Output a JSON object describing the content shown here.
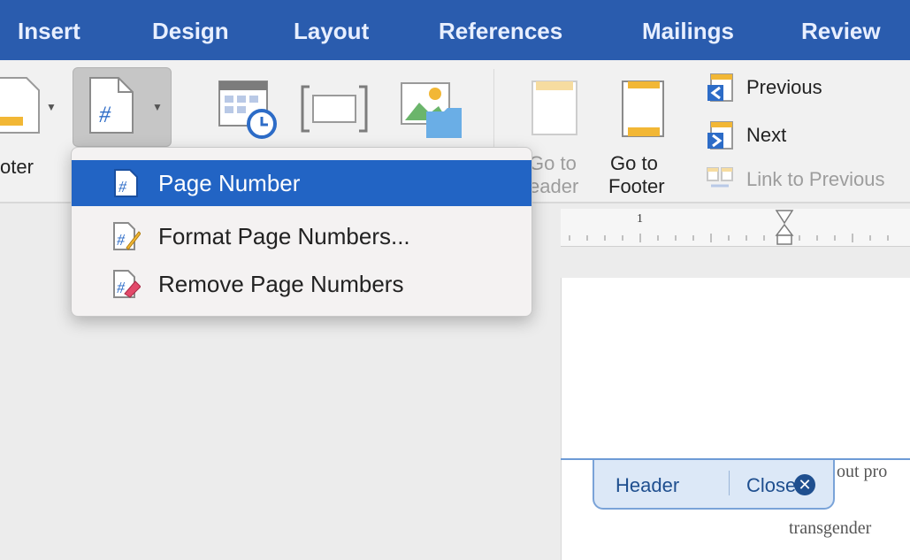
{
  "ribbon": {
    "tabs": [
      {
        "label": "Insert"
      },
      {
        "label": "Design"
      },
      {
        "label": "Layout"
      },
      {
        "label": "References"
      },
      {
        "label": "Mailings"
      },
      {
        "label": "Review"
      }
    ]
  },
  "toolbar": {
    "footer_label": "oter",
    "go_to_header_line1": "Go to",
    "go_to_header_line2": "eader",
    "go_to_footer_line1": "Go to",
    "go_to_footer_line2": "Footer",
    "previous_label": "Previous",
    "next_label": "Next",
    "link_to_previous_label": "Link to Previous"
  },
  "ruler": {
    "marker": "1"
  },
  "dropdown": {
    "items": [
      {
        "label": "Page Number",
        "icon": "page-number-icon",
        "selected": true
      },
      {
        "label": "Format Page Numbers...",
        "icon": "format-page-numbers-icon",
        "selected": false
      },
      {
        "label": "Remove Page Numbers",
        "icon": "remove-page-numbers-icon",
        "selected": false
      }
    ]
  },
  "header_tab": {
    "label": "Header",
    "close_label": "Close",
    "close_glyph": "✕"
  },
  "document": {
    "line1": "out pro",
    "line2": "transgender"
  },
  "colors": {
    "ribbon_blue": "#2a5cae",
    "menu_highlight": "#2264c4",
    "header_blue": "#1f4f8f"
  }
}
